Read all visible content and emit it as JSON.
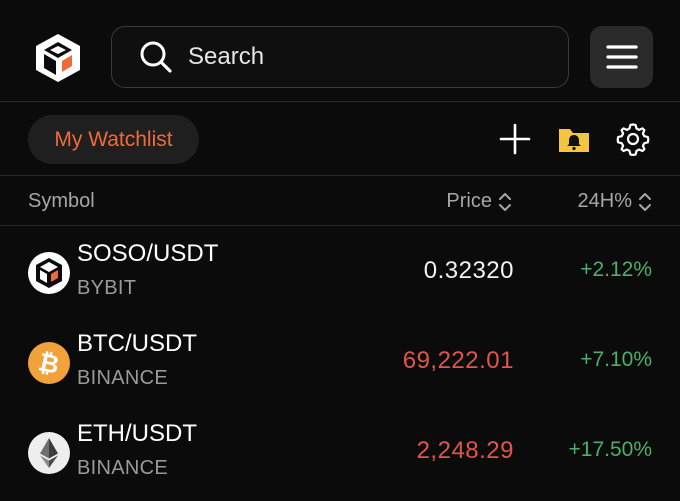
{
  "search": {
    "placeholder": "Search"
  },
  "toolbar": {
    "watchlist_label": "My Watchlist"
  },
  "table": {
    "headers": {
      "symbol": "Symbol",
      "price": "Price",
      "change": "24H%"
    },
    "rows": [
      {
        "pair": "SOSO/USDT",
        "exchange": "BYBIT",
        "price": "0.32320",
        "change": "+2.12%",
        "icon": "soso-logo-icon"
      },
      {
        "pair": "BTC/USDT",
        "exchange": "BINANCE",
        "price": "69,222.01",
        "change": "+7.10%",
        "icon": "bitcoin-icon"
      },
      {
        "pair": "ETH/USDT",
        "exchange": "BINANCE",
        "price": "2,248.29",
        "change": "+17.50%",
        "icon": "ethereum-icon"
      }
    ]
  },
  "colors": {
    "accent": "#ee6a3a",
    "positive": "#4caf6a",
    "price_down": "#e0564b",
    "price_neutral": "#f2f2f2",
    "bitcoin": "#f2a23a",
    "alert_folder": "#f5c542"
  }
}
